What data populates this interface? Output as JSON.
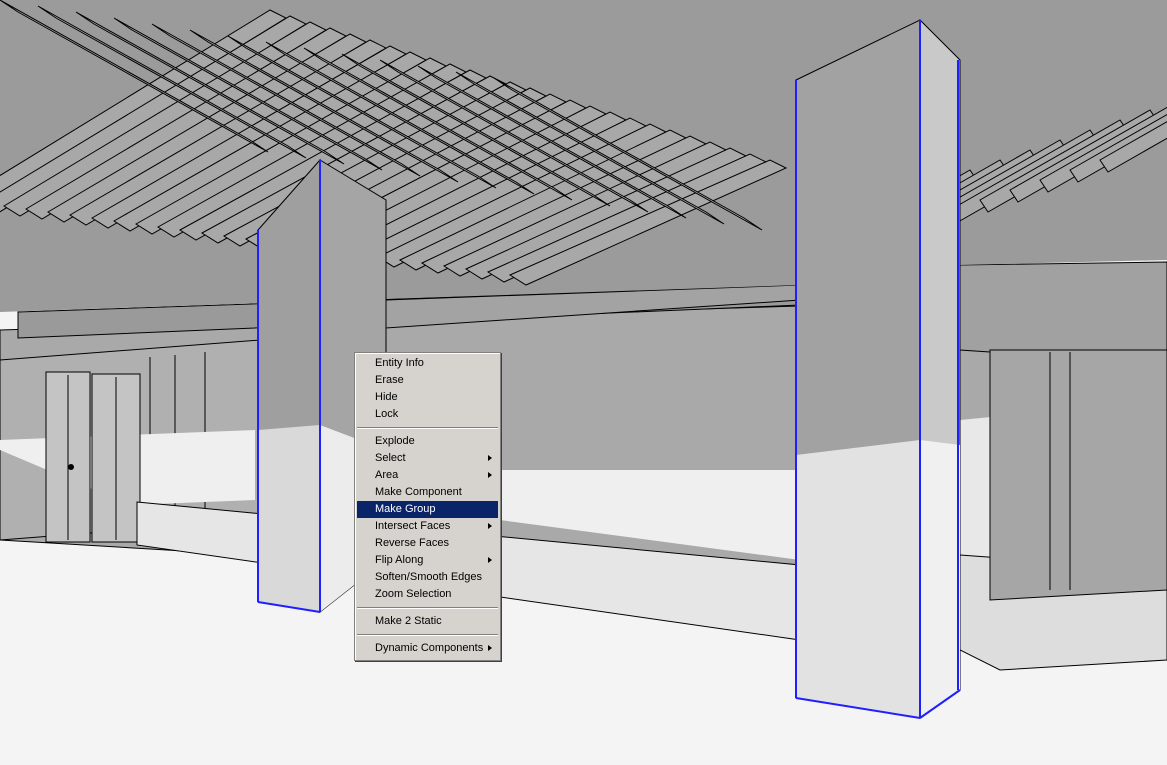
{
  "scene": {
    "title": "",
    "colors": {
      "background": "#f4f4f4",
      "surface": "#a8a8a8",
      "light_surface": "#d9d9d9",
      "edge": "#000000",
      "selection": "#1f1fff"
    }
  },
  "context_menu": {
    "items": [
      {
        "label": "Entity Info",
        "has_submenu": false,
        "highlighted": false
      },
      {
        "label": "Erase",
        "has_submenu": false,
        "highlighted": false
      },
      {
        "label": "Hide",
        "has_submenu": false,
        "highlighted": false
      },
      {
        "label": "Lock",
        "has_submenu": false,
        "highlighted": false
      },
      {
        "separator": true
      },
      {
        "label": "Explode",
        "has_submenu": false,
        "highlighted": false
      },
      {
        "label": "Select",
        "has_submenu": true,
        "highlighted": false
      },
      {
        "label": "Area",
        "has_submenu": true,
        "highlighted": false
      },
      {
        "label": "Make Component",
        "has_submenu": false,
        "highlighted": false
      },
      {
        "label": "Make Group",
        "has_submenu": false,
        "highlighted": true
      },
      {
        "label": "Intersect Faces",
        "has_submenu": true,
        "highlighted": false
      },
      {
        "label": "Reverse Faces",
        "has_submenu": false,
        "highlighted": false
      },
      {
        "label": "Flip Along",
        "has_submenu": true,
        "highlighted": false
      },
      {
        "label": "Soften/Smooth Edges",
        "has_submenu": false,
        "highlighted": false
      },
      {
        "label": "Zoom Selection",
        "has_submenu": false,
        "highlighted": false
      },
      {
        "separator": true
      },
      {
        "label": "Make 2 Static",
        "has_submenu": false,
        "highlighted": false
      },
      {
        "separator": true
      },
      {
        "label": "Dynamic Components",
        "has_submenu": true,
        "highlighted": false
      }
    ]
  }
}
